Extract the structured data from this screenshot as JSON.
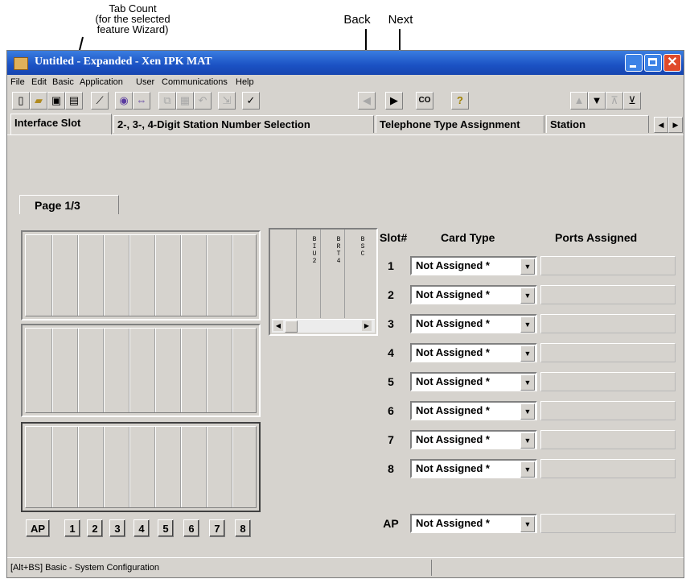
{
  "callouts": {
    "tab_count_line1": "Tab Count",
    "tab_count_line2": "(for the selected",
    "tab_count_line3": "feature Wizard)",
    "back": "Back",
    "next": "Next"
  },
  "window": {
    "title": "Untitled - Expanded - Xen IPK MAT",
    "title_buttons": [
      "minimize-icon",
      "maximize-icon",
      "close-icon"
    ],
    "accent_color": "#1b52c4",
    "close_color": "#e04a2a"
  },
  "menu": [
    "File",
    "Edit",
    "Basic",
    "Application",
    "User",
    "Communications",
    "Help"
  ],
  "toolbar": {
    "icons": [
      "new-icon",
      "open-icon",
      "save-icon",
      "print-icon",
      "wand-icon",
      "globe-icon",
      "link-icon",
      "copy-icon",
      "paste-icon",
      "undo-icon",
      "export-icon",
      "check-icon",
      "back-icon",
      "next-icon",
      "co-icon",
      "help-icon",
      "up-icon",
      "down-icon",
      "top-icon",
      "bottom-icon"
    ],
    "co_label": "CO"
  },
  "tabs": [
    "Interface Slot",
    "2-, 3-, 4-Digit Station Number Selection",
    "Telephone Type Assignment",
    "Station"
  ],
  "page_label": "Page 1/3",
  "card_list": {
    "cards": [
      "BIU2",
      "BRT4",
      "BSC"
    ]
  },
  "headers": {
    "slot": "Slot#",
    "card_type": "Card Type",
    "ports": "Ports Assigned"
  },
  "slots": [
    {
      "num": "1",
      "card": "Not Assigned *"
    },
    {
      "num": "2",
      "card": "Not Assigned *"
    },
    {
      "num": "3",
      "card": "Not Assigned *"
    },
    {
      "num": "4",
      "card": "Not Assigned *"
    },
    {
      "num": "5",
      "card": "Not Assigned *"
    },
    {
      "num": "6",
      "card": "Not Assigned *"
    },
    {
      "num": "7",
      "card": "Not Assigned *"
    },
    {
      "num": "8",
      "card": "Not Assigned *"
    }
  ],
  "ap_slot": {
    "num": "AP",
    "card": "Not Assigned *"
  },
  "slot_buttons": [
    "AP",
    "1",
    "2",
    "3",
    "4",
    "5",
    "6",
    "7",
    "8"
  ],
  "status": "[Alt+BS] Basic - System Configuration"
}
